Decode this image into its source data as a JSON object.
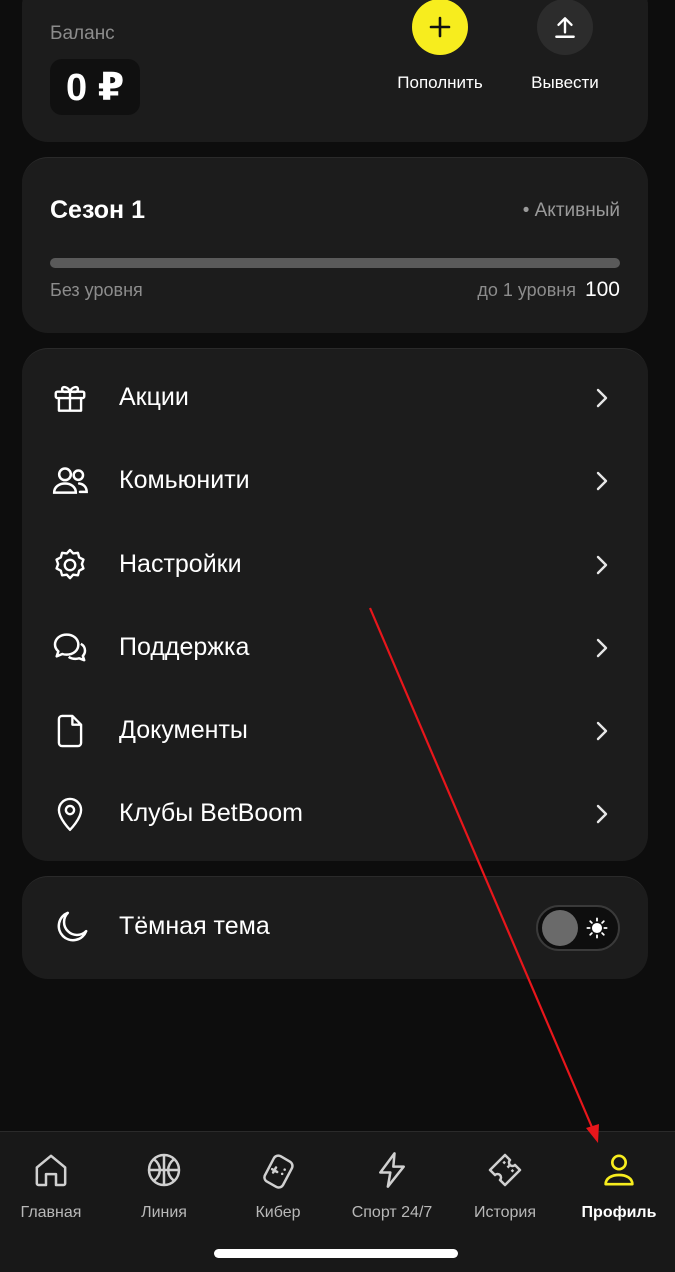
{
  "balance": {
    "label": "Баланс",
    "value": "0 ₽",
    "actions": [
      {
        "label": "Пополнить",
        "icon": "plus-icon"
      },
      {
        "label": "Вывести",
        "icon": "upload-icon"
      }
    ]
  },
  "season": {
    "title": "Сезон 1",
    "status": "• Активный",
    "progress_percent": 0,
    "current_level": "Без уровня",
    "next_level_label": "до 1 уровня",
    "next_level_points": "100"
  },
  "menu": {
    "items": [
      {
        "label": "Акции",
        "icon": "gift-icon"
      },
      {
        "label": "Комьюнити",
        "icon": "users-icon"
      },
      {
        "label": "Настройки",
        "icon": "gear-icon"
      },
      {
        "label": "Поддержка",
        "icon": "chat-bubbles-icon"
      },
      {
        "label": "Документы",
        "icon": "document-icon"
      },
      {
        "label": "Клубы BetBoom",
        "icon": "map-pin-icon"
      }
    ]
  },
  "theme": {
    "label": "Тёмная тема",
    "enabled": false
  },
  "bottom_nav": {
    "items": [
      {
        "label": "Главная",
        "icon": "home-icon"
      },
      {
        "label": "Линия",
        "icon": "basketball-icon"
      },
      {
        "label": "Кибер",
        "icon": "gamepad-icon"
      },
      {
        "label": "Спорт 24/7",
        "icon": "lightning-icon"
      },
      {
        "label": "История",
        "icon": "ticket-icon"
      },
      {
        "label": "Профиль",
        "icon": "user-icon"
      }
    ],
    "active_index": 5
  },
  "colors": {
    "accent": "#f7ed1e",
    "background": "#0d0d0d",
    "card": "#1c1c1c",
    "annotation_arrow": "#e8161b"
  }
}
